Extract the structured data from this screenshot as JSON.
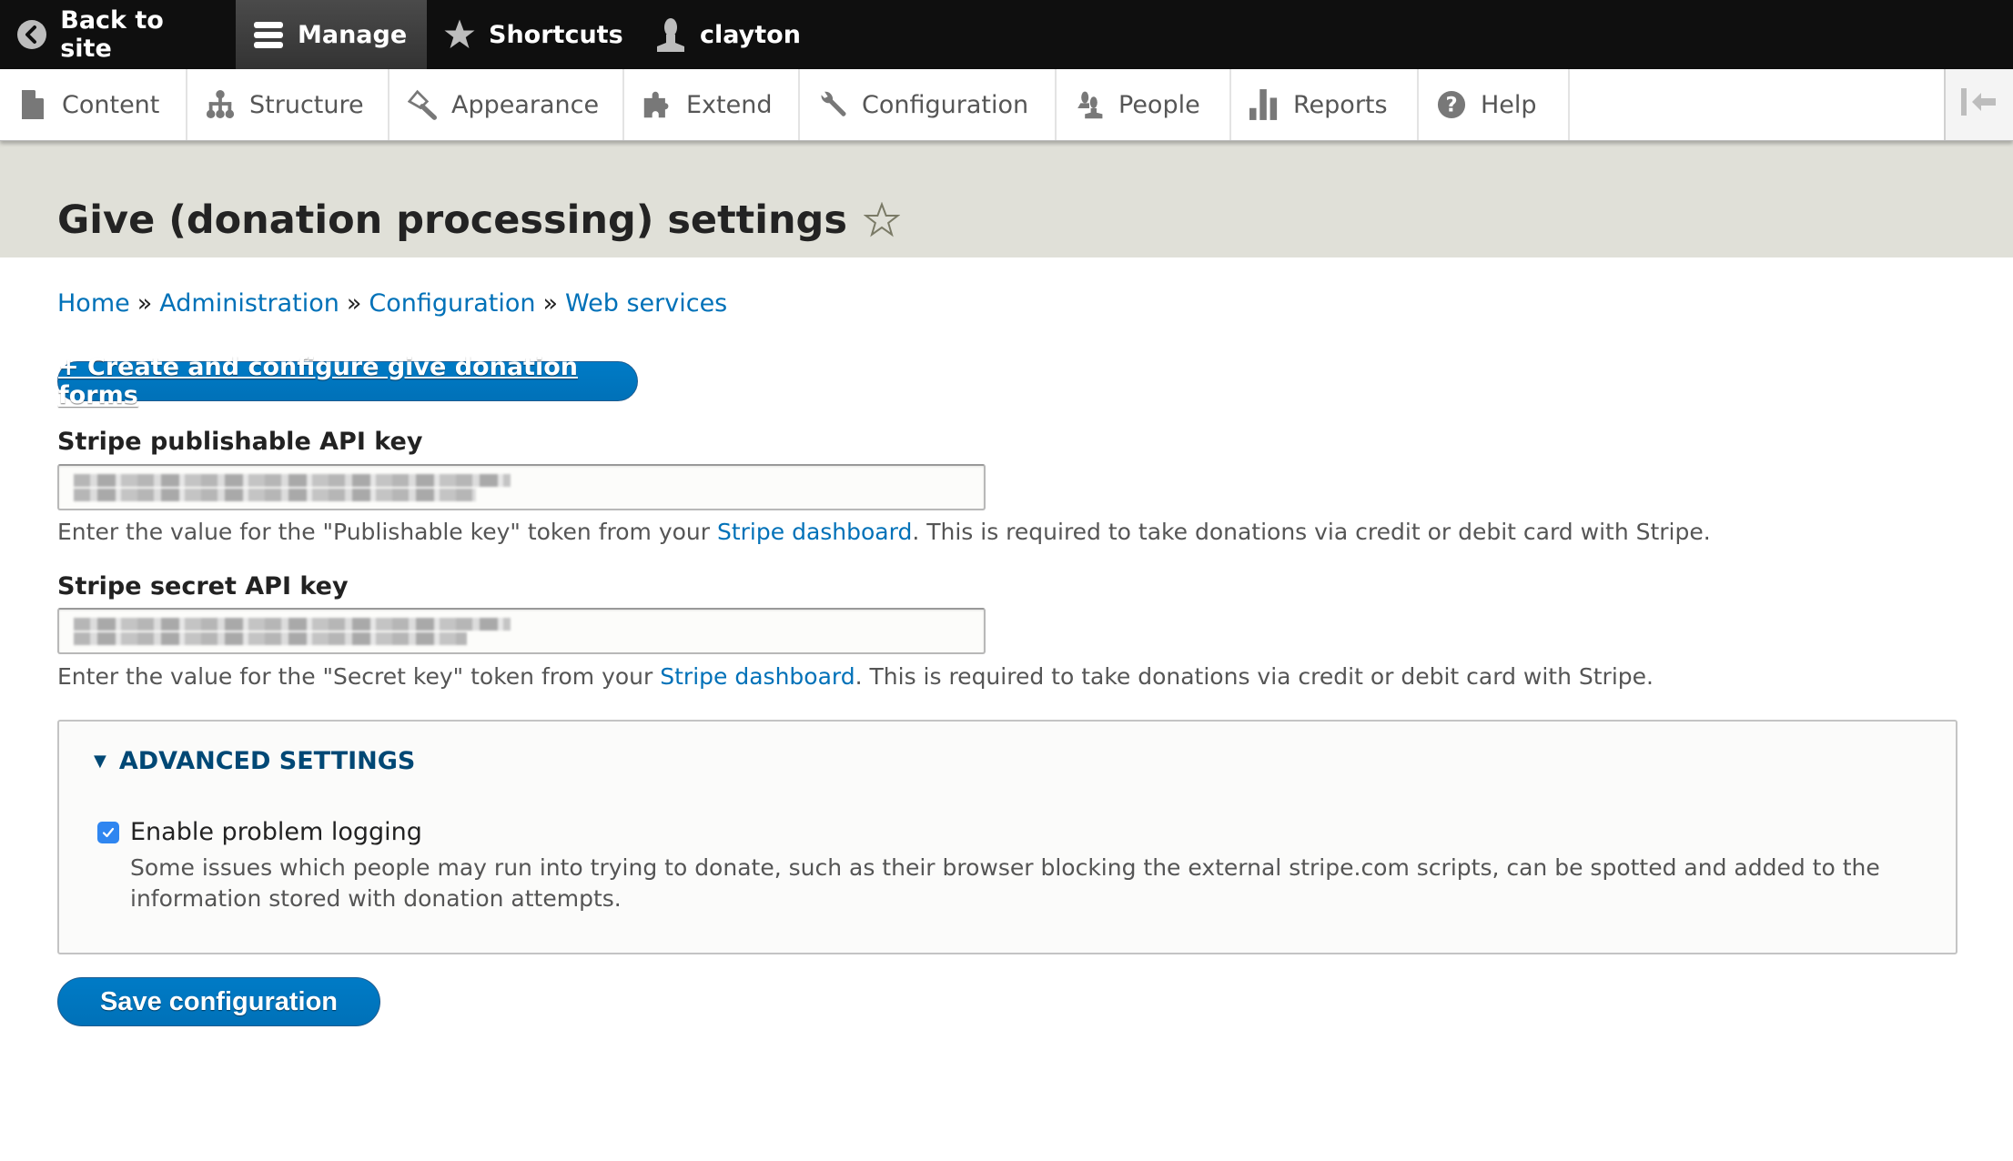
{
  "toolbar": {
    "back_to_site": "Back to site",
    "manage": "Manage",
    "shortcuts": "Shortcuts",
    "user": "clayton"
  },
  "tray": {
    "items": [
      {
        "label": "Content",
        "icon": "file-icon"
      },
      {
        "label": "Structure",
        "icon": "sitemap-icon"
      },
      {
        "label": "Appearance",
        "icon": "paintbrush-icon"
      },
      {
        "label": "Extend",
        "icon": "puzzle-icon"
      },
      {
        "label": "Configuration",
        "icon": "wrench-icon"
      },
      {
        "label": "People",
        "icon": "people-icon"
      },
      {
        "label": "Reports",
        "icon": "bar-chart-icon"
      },
      {
        "label": "Help",
        "icon": "help-icon"
      }
    ],
    "toggle_icon": "collapse-left-icon"
  },
  "header": {
    "title": "Give (donation processing) settings"
  },
  "breadcrumb": {
    "items": [
      "Home",
      "Administration",
      "Configuration",
      "Web services"
    ],
    "separator": "»"
  },
  "actions": {
    "create_forms": "+ Create and configure give donation forms"
  },
  "form": {
    "publishable_key": {
      "label": "Stripe publishable API key",
      "value_state": "redacted (blurred)",
      "help_prefix": "Enter the value for the \"Publishable key\" token from your ",
      "help_link": "Stripe dashboard",
      "help_suffix": ". This is required to take donations via credit or debit card with Stripe."
    },
    "secret_key": {
      "label": "Stripe secret API key",
      "value_state": "redacted (blurred)",
      "help_prefix": "Enter the value for the \"Secret key\" token from your ",
      "help_link": "Stripe dashboard",
      "help_suffix": ". This is required to take donations via credit or debit card with Stripe."
    },
    "advanced": {
      "legend": "ADVANCED SETTINGS",
      "expanded": true,
      "problem_logging": {
        "label": "Enable problem logging",
        "checked": true,
        "description": "Some issues which people may run into trying to donate, such as their browser blocking the external stripe.com scripts, can be spotted and added to the information stored with donation attempts."
      }
    },
    "save": "Save configuration"
  },
  "colors": {
    "primary": "#0071b8",
    "link": "#0071b8",
    "legend": "#004875",
    "toolbar_bg": "#0f0f0f",
    "header_bg": "#e0e0d8"
  }
}
